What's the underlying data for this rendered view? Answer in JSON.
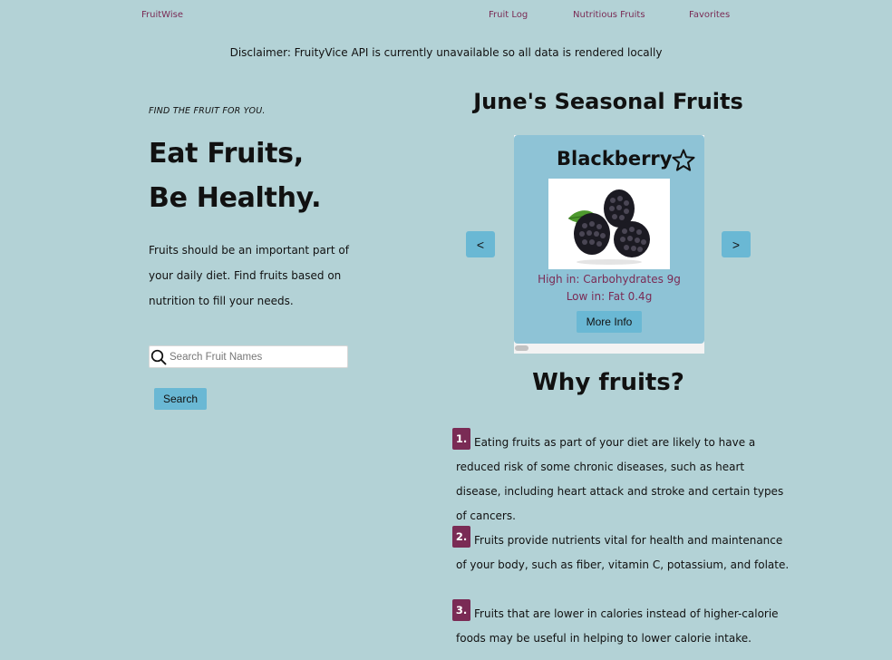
{
  "nav": {
    "brand": "FruitWise",
    "links": [
      "Fruit Log",
      "Nutritious Fruits",
      "Favorites"
    ]
  },
  "disclaimer": "Disclaimer: FruityVice API is currently unavailable so all data is rendered locally",
  "hero": {
    "tagline": "FIND THE FRUIT FOR YOU.",
    "headline_1": "Eat Fruits,",
    "headline_2": "Be Healthy.",
    "intro": "Fruits should be an important part of your daily diet. Find fruits based on nutrition to fill your needs."
  },
  "search": {
    "placeholder": "Search Fruit Names",
    "value": "",
    "button_label": "Search"
  },
  "seasonal": {
    "title": "June's Seasonal Fruits",
    "prev_label": "<",
    "next_label": ">",
    "card": {
      "name": "Blackberry",
      "high": "High in: Carbohydrates 9g",
      "low": "Low in: Fat 0.4g",
      "button_label": "More Info"
    }
  },
  "why": {
    "title": "Why fruits?",
    "reasons": [
      {
        "number": "1.",
        "text": "Eating fruits as part of your diet are likely to have a reduced risk of some chronic diseases, such as heart disease, including heart attack and stroke and certain types of cancers."
      },
      {
        "number": "2.",
        "text": "Fruits provide nutrients vital for health and maintenance of your body, such as fiber, vitamin C, potassium, and folate."
      },
      {
        "number": "3.",
        "text": "Fruits that are lower in calories instead of higher-calorie foods may be useful in helping to lower calorie intake."
      }
    ]
  },
  "colors": {
    "background": "#b3d2d6",
    "accent": "#6ab8d4",
    "card": "#8ec3d6",
    "brand": "#7a2b55"
  }
}
